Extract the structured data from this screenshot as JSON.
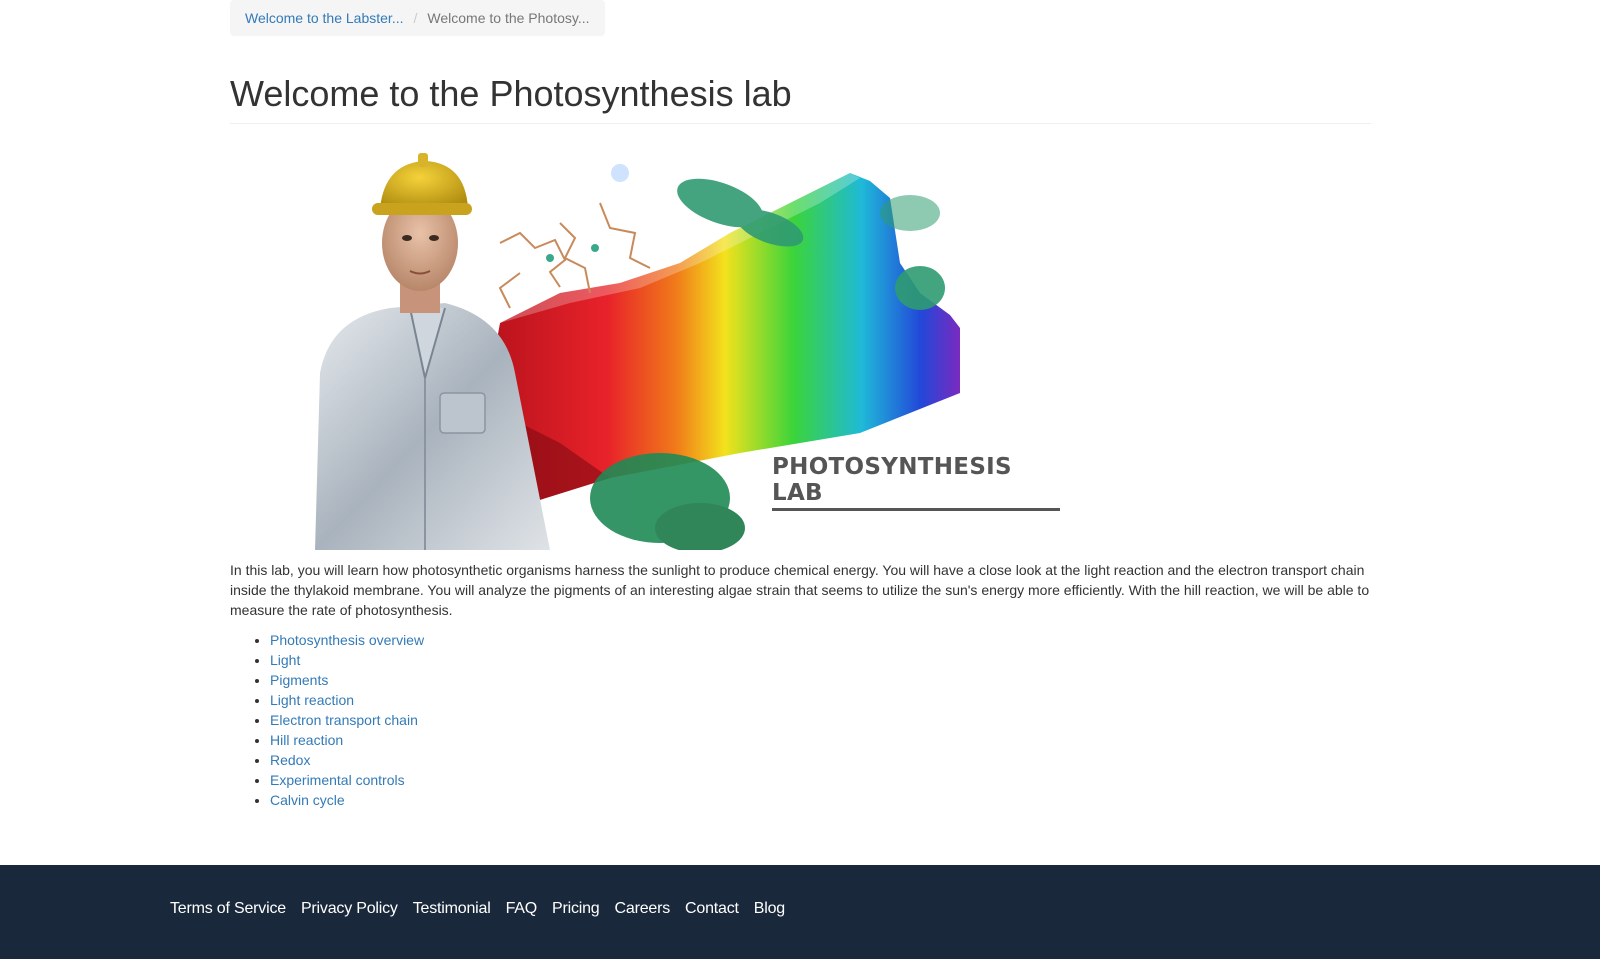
{
  "breadcrumb": {
    "items": [
      {
        "label": "Welcome to the Labster..."
      },
      {
        "label": "Welcome to the Photosy..."
      }
    ],
    "separator": "/"
  },
  "page": {
    "title": "Welcome to the Photosynthesis lab"
  },
  "banner": {
    "title": "PHOTOSYNTHESIS LAB"
  },
  "intro": "In this lab, you will learn how photosynthetic organisms harness the sunlight to produce chemical energy. You will have a close look at the light reaction and the electron transport chain inside the thylakoid membrane. You will analyze the pigments of an interesting algae strain that seems to utilize the sun's energy more efficiently. With the hill reaction, we will be able to measure the rate of photosynthesis.",
  "topics": [
    {
      "label": "Photosynthesis overview"
    },
    {
      "label": "Light"
    },
    {
      "label": "Pigments"
    },
    {
      "label": "Light reaction"
    },
    {
      "label": "Electron transport chain"
    },
    {
      "label": "Hill reaction"
    },
    {
      "label": "Redox"
    },
    {
      "label": "Experimental controls"
    },
    {
      "label": "Calvin cycle"
    }
  ],
  "footer": {
    "links": [
      {
        "label": "Terms of Service"
      },
      {
        "label": "Privacy Policy"
      },
      {
        "label": "Testimonial"
      },
      {
        "label": "FAQ"
      },
      {
        "label": "Pricing"
      },
      {
        "label": "Careers"
      },
      {
        "label": "Contact"
      },
      {
        "label": "Blog"
      }
    ]
  },
  "colors": {
    "link": "#337ab7",
    "footer_bg": "#19283a",
    "breadcrumb_bg": "#f5f5f5"
  }
}
